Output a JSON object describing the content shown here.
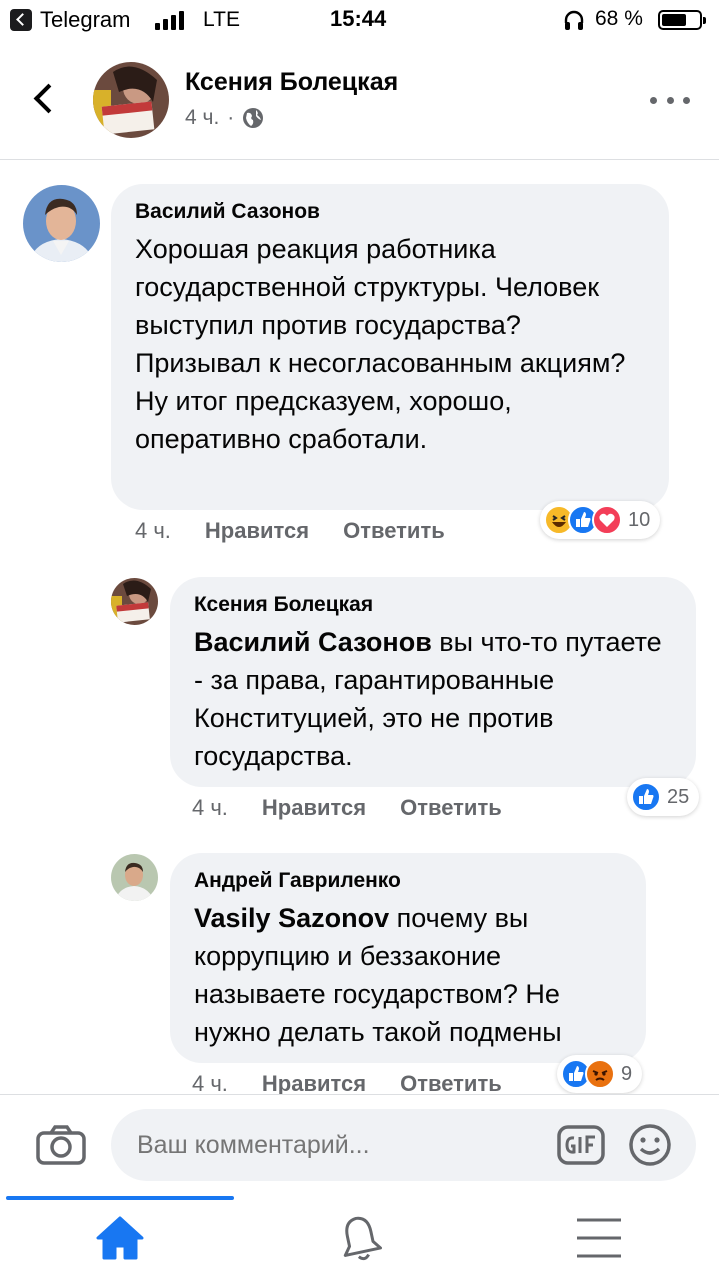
{
  "status_bar": {
    "app_back_label": "Telegram",
    "network": "LTE",
    "time": "15:44",
    "battery_percent_text": "68 %",
    "battery_level": 0.68
  },
  "header": {
    "name": "Ксения Болецкая",
    "time": "4 ч.",
    "separator": "·",
    "privacy_icon": "globe-icon",
    "more_icon": "more-dots-icon"
  },
  "comments": [
    {
      "author": "Василий Сазонов",
      "mention": "",
      "text": "Хорошая реакция работника государственной структуры. Человек выступил против государства? Призывал к несогласованным акциям? Ну итог предсказуем, хорошо, оперативно сработали.",
      "time": "4 ч.",
      "like_label": "Нравится",
      "reply_label": "Ответить",
      "reactions": [
        "haha",
        "like",
        "love"
      ],
      "reaction_count": "10"
    },
    {
      "author": "Ксения Болецкая",
      "mention": "Василий Сазонов",
      "text": " вы что-то путаете - за права, гарантированные Конституцией, это не против государства.",
      "time": "4 ч.",
      "like_label": "Нравится",
      "reply_label": "Ответить",
      "reactions": [
        "like"
      ],
      "reaction_count": "25"
    },
    {
      "author": "Андрей Гавриленко",
      "mention": "Vasily  Sazonov",
      "text": " почему вы коррупцию и беззаконие называете государством? Не нужно делать такой подмены",
      "time": "4 ч.",
      "like_label": "Нравится",
      "reply_label": "Ответить",
      "reactions": [
        "like",
        "angry"
      ],
      "reaction_count": "9"
    }
  ],
  "composer": {
    "placeholder": "Ваш комментарий...",
    "camera_icon": "camera-icon",
    "gif_icon": "gif-icon",
    "emoji_icon": "smile-icon"
  },
  "tabbar": {
    "active": "home",
    "tabs": [
      "home-icon",
      "bell-icon",
      "menu-icon"
    ]
  },
  "colors": {
    "accent": "#1877f2",
    "bubble": "#f0f2f5",
    "secondary_text": "#65676b"
  }
}
